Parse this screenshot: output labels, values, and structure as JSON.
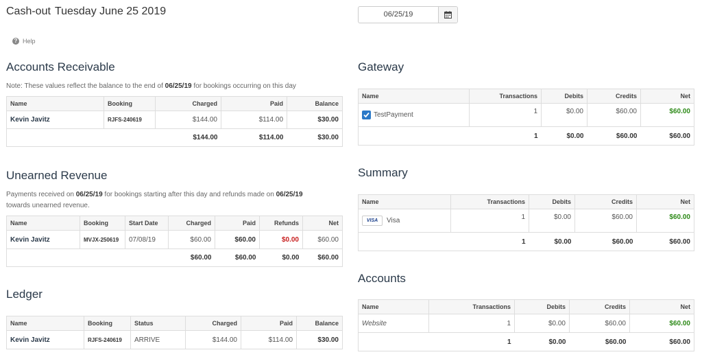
{
  "header": {
    "title": "Cash-out",
    "date_text": "Tuesday June 25 2019",
    "help_label": "Help"
  },
  "date_picker": {
    "value": "06/25/19"
  },
  "accounts_receivable": {
    "title": "Accounts Receivable",
    "note_prefix": "Note: These values reflect the balance to the end of ",
    "note_date": "06/25/19",
    "note_suffix": " for bookings occurring on this day",
    "columns": [
      "Name",
      "Booking",
      "Charged",
      "Paid",
      "Balance"
    ],
    "rows": [
      {
        "name": "Kevin Javitz",
        "booking": "RJFS-240619",
        "charged": "$144.00",
        "paid": "$114.00",
        "balance": "$30.00"
      }
    ],
    "totals": {
      "charged": "$144.00",
      "paid": "$114.00",
      "balance": "$30.00"
    }
  },
  "unearned_revenue": {
    "title": "Unearned Revenue",
    "note_p1": "Payments received on ",
    "note_d1": "06/25/19",
    "note_p2": " for bookings starting after this day and refunds made on ",
    "note_d2": "06/25/19",
    "note_p3": "towards unearned revenue.",
    "columns": [
      "Name",
      "Booking",
      "Start Date",
      "Charged",
      "Paid",
      "Refunds",
      "Net"
    ],
    "rows": [
      {
        "name": "Kevin Javitz",
        "booking": "MVJX-250619",
        "start_date": "07/08/19",
        "charged": "$60.00",
        "paid": "$60.00",
        "refunds": "$0.00",
        "net": "$60.00"
      }
    ],
    "totals": {
      "charged": "$60.00",
      "paid": "$60.00",
      "refunds": "$0.00",
      "net": "$60.00"
    }
  },
  "ledger": {
    "title": "Ledger",
    "columns": [
      "Name",
      "Booking",
      "Status",
      "Charged",
      "Paid",
      "Balance"
    ],
    "rows": [
      {
        "name": "Kevin Javitz",
        "booking": "RJFS-240619",
        "status": "ARRIVE",
        "charged": "$144.00",
        "paid": "$114.00",
        "balance": "$30.00"
      }
    ]
  },
  "gateway": {
    "title": "Gateway",
    "columns": [
      "Name",
      "Transactions",
      "Debits",
      "Credits",
      "Net"
    ],
    "rows": [
      {
        "name": "TestPayment",
        "transactions": "1",
        "debits": "$0.00",
        "credits": "$60.00",
        "net": "$60.00"
      }
    ],
    "totals": {
      "transactions": "1",
      "debits": "$0.00",
      "credits": "$60.00",
      "net": "$60.00"
    }
  },
  "summary": {
    "title": "Summary",
    "columns": [
      "Name",
      "Transactions",
      "Debits",
      "Credits",
      "Net"
    ],
    "rows": [
      {
        "card": "VISA",
        "name": "Visa",
        "transactions": "1",
        "debits": "$0.00",
        "credits": "$60.00",
        "net": "$60.00"
      }
    ],
    "totals": {
      "transactions": "1",
      "debits": "$0.00",
      "credits": "$60.00",
      "net": "$60.00"
    }
  },
  "accounts": {
    "title": "Accounts",
    "columns": [
      "Name",
      "Transactions",
      "Debits",
      "Credits",
      "Net"
    ],
    "rows": [
      {
        "name": "Website",
        "transactions": "1",
        "debits": "$0.00",
        "credits": "$60.00",
        "net": "$60.00"
      }
    ],
    "totals": {
      "transactions": "1",
      "debits": "$0.00",
      "credits": "$60.00",
      "net": "$60.00"
    }
  },
  "colors": {
    "accent": "#2a79c8",
    "negative": "#c82020",
    "positive": "#2e8a19",
    "heading": "#2b3a4a"
  }
}
